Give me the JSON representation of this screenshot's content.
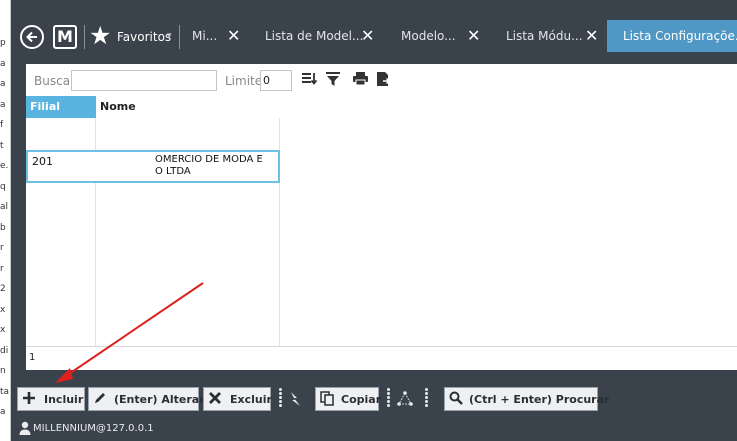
{
  "topbar": {
    "favorites_label": "Favoritos",
    "tabs": [
      {
        "label": "Mi..."
      },
      {
        "label": "Lista de Model..."
      },
      {
        "label": "Modelo..."
      },
      {
        "label": "Lista Módu..."
      },
      {
        "label": "Lista Configuraçõe..."
      }
    ]
  },
  "search": {
    "label": "Buscar",
    "value": "",
    "limit_label": "Limite",
    "limit_value": "0"
  },
  "grid": {
    "columns": [
      "Filial",
      "Nome"
    ],
    "rows": [
      {
        "filial": "201",
        "nome_line1": "OMERCIO DE MODA E",
        "nome_line2": "O LTDA"
      }
    ],
    "record_count": "1"
  },
  "actions": {
    "incluir": "Incluir",
    "alterar": "(Enter) Alterar",
    "excluir": "Excluir",
    "copiar": "Copiar",
    "procurar": "(Ctrl + Enter) Procurar"
  },
  "status": {
    "user_host": "MILLENNIUM@127.0.0.1"
  },
  "colors": {
    "background": "#3a424c",
    "active_tab": "#4f97c4",
    "header_highlight": "#59b4e0",
    "annotation_arrow": "#e0201c"
  },
  "left_strip_chars": [
    "p",
    "a",
    "a",
    "a",
    "f",
    "t",
    "e.",
    "q",
    "al",
    "b",
    "r",
    "r",
    "2",
    "x",
    "x",
    "di",
    "n",
    "ta",
    "a"
  ]
}
